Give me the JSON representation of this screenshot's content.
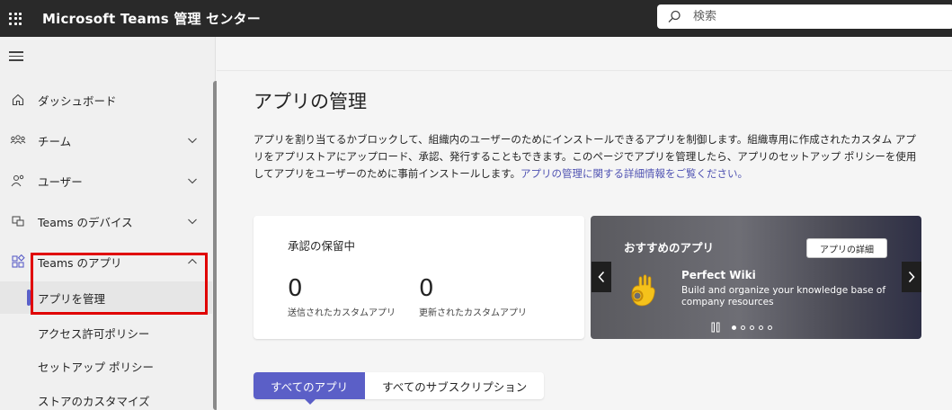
{
  "header": {
    "app_title": "Microsoft Teams 管理 センター",
    "search_placeholder": "検索"
  },
  "sidebar": {
    "items": [
      {
        "label": "ダッシュボード",
        "icon": "home-icon"
      },
      {
        "label": "チーム",
        "icon": "teams-group-icon"
      },
      {
        "label": "ユーザー",
        "icon": "users-icon"
      },
      {
        "label": "Teams のデバイス",
        "icon": "devices-icon"
      },
      {
        "label": "Teams のアプリ",
        "icon": "apps-icon"
      }
    ],
    "subitems": [
      {
        "label": "アプリを管理",
        "active": true
      },
      {
        "label": "アクセス許可ポリシー"
      },
      {
        "label": "セットアップ ポリシー"
      },
      {
        "label": "ストアのカスタマイズ"
      }
    ]
  },
  "main": {
    "title": "アプリの管理",
    "description": "アプリを割り当てるかブロックして、組織内のユーザーのためにインストールできるアプリを制御します。組織専用に作成されたカスタム アプリをアプリストアにアップロード、承認、発行することもできます。このページでアプリを管理したら、アプリのセットアップ ポリシーを使用してアプリをユーザーのために事前インストールします。",
    "description_link": "アプリの管理に関する詳細情報をご覧ください。",
    "pending": {
      "title": "承認の保留中",
      "submitted_count": "0",
      "submitted_label": "送信されたカスタムアプリ",
      "updated_count": "0",
      "updated_label": "更新されたカスタムアプリ"
    },
    "featured": {
      "title": "おすすめのアプリ",
      "details_button": "アプリの詳細",
      "app_name": "Perfect Wiki",
      "app_description": "Build and organize your knowledge base of company resources",
      "slides_total": 5,
      "slide_current": 1
    },
    "tabs": [
      {
        "label": "すべてのアプリ",
        "active": true
      },
      {
        "label": "すべてのサブスクリプション",
        "active": false
      }
    ]
  },
  "colors": {
    "topbar": "#292929",
    "accent": "#5b5fc7",
    "highlight": "#e00000",
    "link": "#4f52b2"
  }
}
